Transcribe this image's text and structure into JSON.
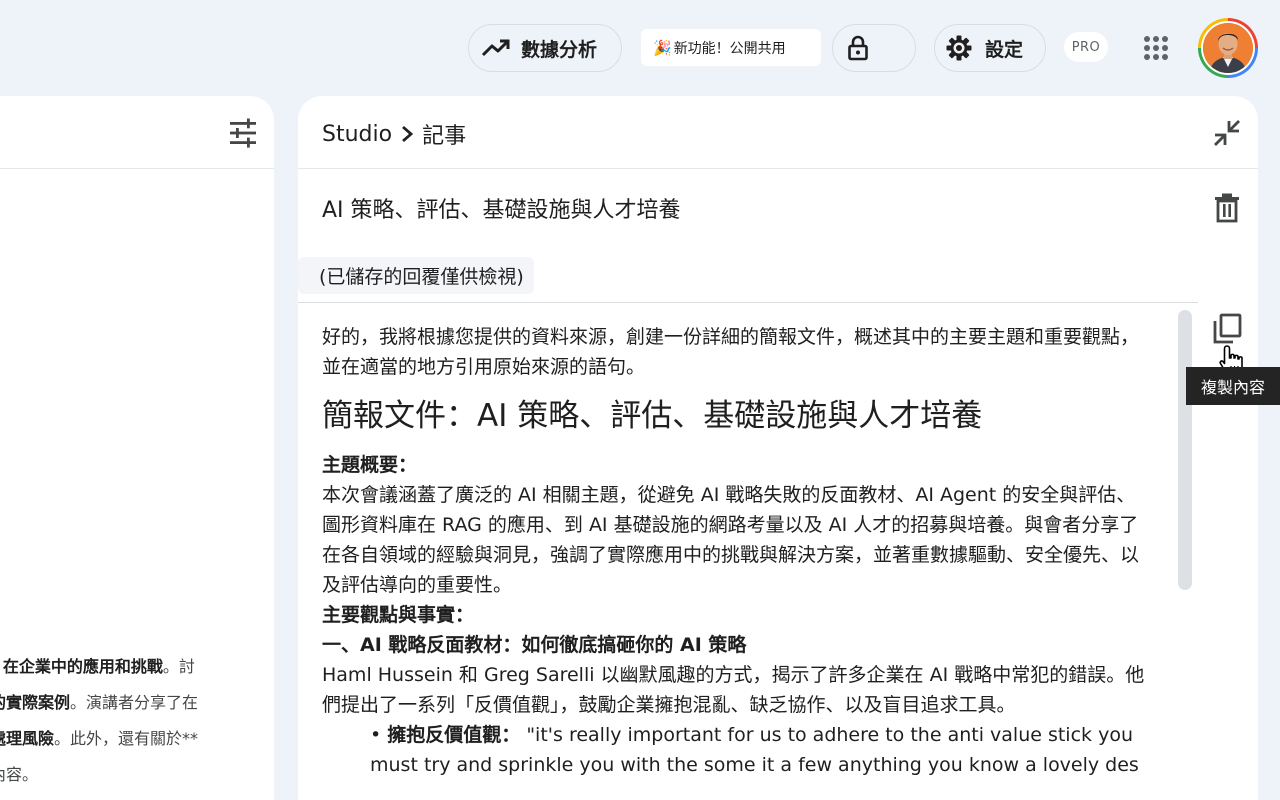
{
  "topbar": {
    "analytics_label": "數據分析",
    "new_feature_label": "新功能！公開共用",
    "new_feature_emoji": "🎉",
    "settings_label": "設定",
    "pro_badge": "PRO"
  },
  "left_panel": {
    "fragments": [
      {
        "bold": ") 在企業中的應用和挑戰",
        "normal": "。討"
      },
      {
        "bold": "的實際案例",
        "normal": "。演講者分享了在"
      },
      {
        "bold": "處理風險",
        "normal": "。此外，還有關於**"
      },
      {
        "bold": "",
        "normal": "內容。"
      }
    ]
  },
  "studio": {
    "breadcrumb_root": "Studio",
    "breadcrumb_current": "記事",
    "note_title": "AI 策略、評估、基礎設施與人才培養",
    "saved_chip": "(已儲存的回覆僅供檢視)",
    "copy_tooltip": "複製內容",
    "content": {
      "intro": "好的，我將根據您提供的資料來源，創建一份詳細的簡報文件，概述其中的主要主題和重要觀點，並在適當的地方引用原始來源的語句。",
      "heading": "簡報文件：AI 策略、評估、基礎設施與人才培養",
      "theme_label": "主題概要：",
      "theme_text": "本次會議涵蓋了廣泛的 AI 相關主題，從避免 AI 戰略失敗的反面教材、AI Agent 的安全與評估、圖形資料庫在 RAG 的應用、到 AI 基礎設施的網路考量以及 AI 人才的招募與培養。與會者分享了在各自領域的經驗與洞見，強調了實際應用中的挑戰與解決方案，並著重數據驅動、安全優先、以及評估導向的重要性。",
      "points_label": "主要觀點與事實：",
      "section1_title": "一、AI 戰略反面教材：如何徹底搞砸你的 AI 策略",
      "section1_text": "Haml Hussein 和 Greg Sarelli 以幽默風趣的方式，揭示了許多企業在 AI 戰略中常犯的錯誤。他們提出了一系列「反價值觀」，鼓勵企業擁抱混亂、缺乏協作、以及盲目追求工具。",
      "bullet1_label": "擁抱反價值觀：",
      "bullet1_text": "\"it's really important for us to adhere to the anti value stick you must try and sprinkle you with the some it a few anything you know a lovely des"
    }
  }
}
